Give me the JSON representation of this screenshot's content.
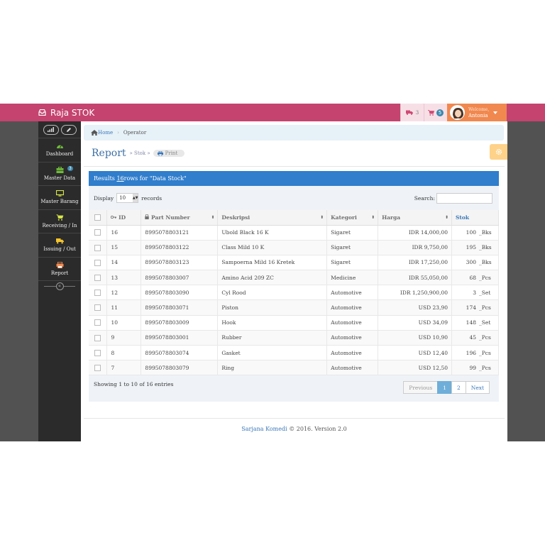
{
  "navbar": {
    "brand": "Raja STOK",
    "truck_count": "3",
    "cart_count": "5",
    "welcome": "Welcome,",
    "user_name": "Antonia"
  },
  "sidebar": {
    "items": [
      {
        "label": "Dashboard",
        "icon": "dashboard-icon"
      },
      {
        "label": "Master Data",
        "icon": "briefcase-icon",
        "badge": "3"
      },
      {
        "label": "Master Barang",
        "icon": "monitor-icon"
      },
      {
        "label": "Receiving / In",
        "icon": "cart-icon"
      },
      {
        "label": "Issuing / Out",
        "icon": "truck-icon"
      },
      {
        "label": "Report",
        "icon": "printer-icon"
      }
    ]
  },
  "breadcrumb": {
    "home": "Home",
    "current": "Operator"
  },
  "page": {
    "title": "Report",
    "subtitle": "» Stok »",
    "print_label": "Print"
  },
  "panel": {
    "header_prefix": "Results ",
    "header_count": "16",
    "header_suffix": " rows for \"Data Stock\"",
    "display_label": "Display",
    "length_value": "10",
    "records_label": "records",
    "search_label": "Search:",
    "search_value": ""
  },
  "table": {
    "columns": [
      "ID",
      "Part Number",
      "Deskripsi",
      "Kategori",
      "Harga",
      "Stok"
    ],
    "rows": [
      {
        "id": "16",
        "part": "8995078803121",
        "desc": "Ubold Black 16 K",
        "cat": "Sigaret",
        "price": "IDR 14,000,00",
        "qty": "100",
        "unit": "_Bks"
      },
      {
        "id": "15",
        "part": "8995078803122",
        "desc": "Class Mild 10 K",
        "cat": "Sigaret",
        "price": "IDR 9,750,00",
        "qty": "195",
        "unit": "_Bks"
      },
      {
        "id": "14",
        "part": "8995078803123",
        "desc": "Sampoerna Mild 16 Kretek",
        "cat": "Sigaret",
        "price": "IDR 17,250,00",
        "qty": "300",
        "unit": "_Bks"
      },
      {
        "id": "13",
        "part": "8995078803007",
        "desc": "Amino Acid 209 ZC",
        "cat": "Medicine",
        "price": "IDR 55,050,00",
        "qty": "68",
        "unit": "_Pcs"
      },
      {
        "id": "12",
        "part": "8995078803090",
        "desc": "Cyl Rood",
        "cat": "Automotive",
        "price": "IDR 1,250,900,00",
        "qty": "3",
        "unit": "_Set"
      },
      {
        "id": "11",
        "part": "8995078803071",
        "desc": "Piston",
        "cat": "Automotive",
        "price": "USD 23,90",
        "qty": "174",
        "unit": "_Pcs"
      },
      {
        "id": "10",
        "part": "8995078803009",
        "desc": "Hook",
        "cat": "Automotive",
        "price": "USD 34,09",
        "qty": "148",
        "unit": "_Set"
      },
      {
        "id": "9",
        "part": "8995078803001",
        "desc": "Rubber",
        "cat": "Automotive",
        "price": "USD 10,90",
        "qty": "45",
        "unit": "_Pcs"
      },
      {
        "id": "8",
        "part": "8995078803074",
        "desc": "Gasket",
        "cat": "Automotive",
        "price": "USD 12,40",
        "qty": "196",
        "unit": "_Pcs"
      },
      {
        "id": "7",
        "part": "8995078803079",
        "desc": "Ring",
        "cat": "Automotive",
        "price": "USD 12,50",
        "qty": "99",
        "unit": "_Pcs"
      }
    ]
  },
  "table_footer": {
    "info": "Showing 1 to 10 of 16 entries",
    "previous": "Previous",
    "pages": [
      "1",
      "2"
    ],
    "next": "Next"
  },
  "footer": {
    "brand": "Sarjana Komedi",
    "text": " © 2016. Version 2.0"
  },
  "colors": {
    "navbar": "#c4436f",
    "user_box": "#f0884f",
    "accent_blue": "#307ecc",
    "sidebar": "#2b2b2b"
  }
}
